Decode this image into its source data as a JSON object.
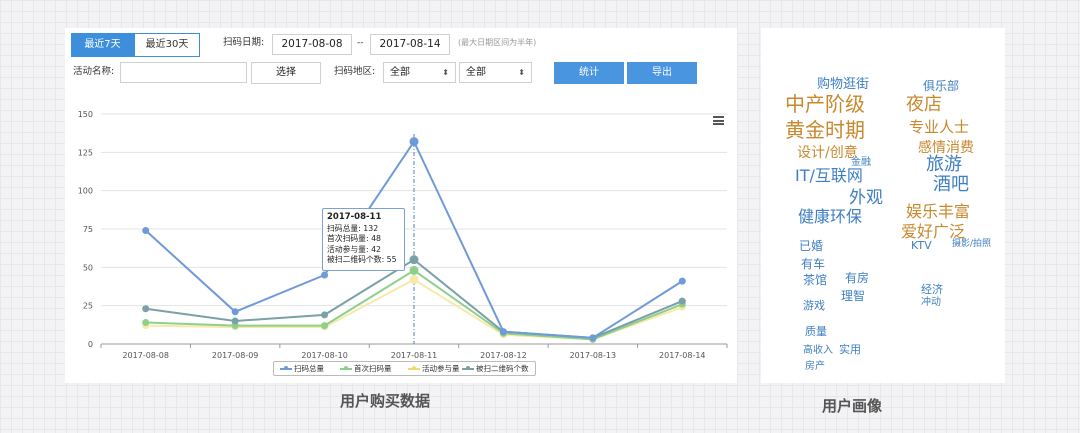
{
  "filters": {
    "btn_7days": "最近7天",
    "btn_30days": "最近30天",
    "scan_date_label": "扫码日期:",
    "date_start": "2017-08-08",
    "date_sep": "--",
    "date_end": "2017-08-14",
    "date_note": "(最大日期区间为半年)",
    "activity_label": "活动名称:",
    "activity_value": "",
    "choose_btn": "选择",
    "region_label": "扫码地区:",
    "region1": "全部",
    "region2": "全部",
    "stats_btn": "统计",
    "export_btn": "导出"
  },
  "chart_data": {
    "type": "line",
    "categories": [
      "2017-08-08",
      "2017-08-09",
      "2017-08-10",
      "2017-08-11",
      "2017-08-12",
      "2017-08-13",
      "2017-08-14"
    ],
    "ylim": [
      0,
      150
    ],
    "yticks": [
      "0",
      "25",
      "50",
      "75",
      "100",
      "125",
      "150"
    ],
    "grid": true,
    "legend_position": "bottom",
    "series": [
      {
        "name": "扫码总量",
        "color": "#6f9ad8",
        "values": [
          74,
          21,
          45,
          132,
          8,
          4,
          41
        ]
      },
      {
        "name": "首次扫码量",
        "color": "#8ed08b",
        "values": [
          14,
          12,
          12,
          48,
          7,
          3,
          26
        ]
      },
      {
        "name": "活动参与量",
        "color": "#f7e9a8",
        "values": [
          12,
          11,
          11,
          42,
          6,
          3,
          24
        ]
      },
      {
        "name": "被扫二维码个数",
        "color": "#7aa0a8",
        "values": [
          23,
          15,
          19,
          55,
          8,
          4,
          28
        ]
      }
    ],
    "tooltip": {
      "title": "2017-08-11",
      "lines": [
        "扫码总量: 132",
        "首次扫码量: 48",
        "活动参与量: 42",
        "被扫二维码个数: 55"
      ]
    }
  },
  "captions": {
    "left": "用户购买数据",
    "right": "用户画像"
  },
  "wordcloud": {
    "words": [
      {
        "text": "中产阶级",
        "color": "#c8882e"
      },
      {
        "text": "黄金时期",
        "color": "#c8882e"
      },
      {
        "text": "夜店",
        "color": "#c8882e"
      },
      {
        "text": "专业人士",
        "color": "#c8882e"
      },
      {
        "text": "感情消费",
        "color": "#c8882e"
      },
      {
        "text": "设计/创意",
        "color": "#c8882e"
      },
      {
        "text": "旅游",
        "color": "#3d7fc2"
      },
      {
        "text": "IT/互联网",
        "color": "#3d7fc2"
      },
      {
        "text": "酒吧",
        "color": "#3d7fc2"
      },
      {
        "text": "外观",
        "color": "#3d7fc2"
      },
      {
        "text": "娱乐丰富",
        "color": "#c8882e"
      },
      {
        "text": "健康环保",
        "color": "#3d7fc2"
      },
      {
        "text": "爱好广泛",
        "color": "#c8882e"
      },
      {
        "text": "购物逛街",
        "color": "#3d7fc2"
      },
      {
        "text": "俱乐部",
        "color": "#3d7fc2"
      },
      {
        "text": "已婚",
        "color": "#3d7fc2"
      },
      {
        "text": "KTV",
        "color": "#3d7fc2"
      },
      {
        "text": "有车",
        "color": "#3d7fc2"
      },
      {
        "text": "有房",
        "color": "#3d7fc2"
      },
      {
        "text": "茶馆",
        "color": "#3d7fc2"
      },
      {
        "text": "理智",
        "color": "#3d7fc2"
      },
      {
        "text": "游戏",
        "color": "#3d7fc2"
      },
      {
        "text": "实用",
        "color": "#3d7fc2"
      },
      {
        "text": "质量",
        "color": "#3d7fc2"
      },
      {
        "text": "经济",
        "color": "#3d7fc2"
      },
      {
        "text": "冲动",
        "color": "#3d7fc2"
      },
      {
        "text": "摄影/拍照",
        "color": "#3d7fc2"
      },
      {
        "text": "金融",
        "color": "#3d7fc2"
      },
      {
        "text": "高收入",
        "color": "#3d7fc2"
      },
      {
        "text": "房产",
        "color": "#3d7fc2"
      }
    ]
  }
}
